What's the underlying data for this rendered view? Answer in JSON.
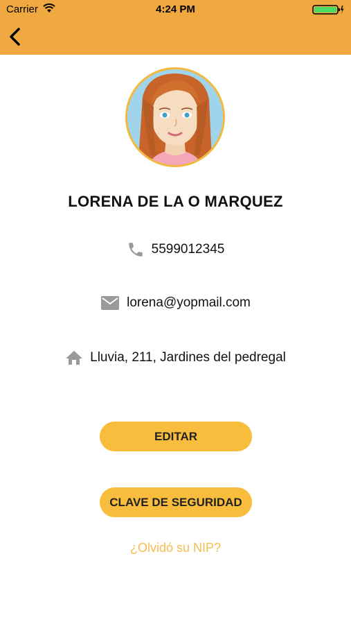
{
  "status_bar": {
    "carrier": "Carrier",
    "time": "4:24 PM"
  },
  "header": {
    "back_icon": "chevron-left-icon",
    "color": "#F0A840"
  },
  "profile": {
    "name": "LORENA DE LA O MARQUEZ",
    "phone": "5599012345",
    "email": "lorena@yopmail.com",
    "address": "Lluvia, 211, Jardines del pedregal"
  },
  "actions": {
    "edit_label": "EDITAR",
    "security_label": "CLAVE DE SEGURIDAD",
    "forgot_label": "¿Olvidó su NIP?"
  },
  "colors": {
    "accent": "#F8BD3C",
    "link": "#F5BD4A",
    "icon": "#9A9A9A"
  }
}
